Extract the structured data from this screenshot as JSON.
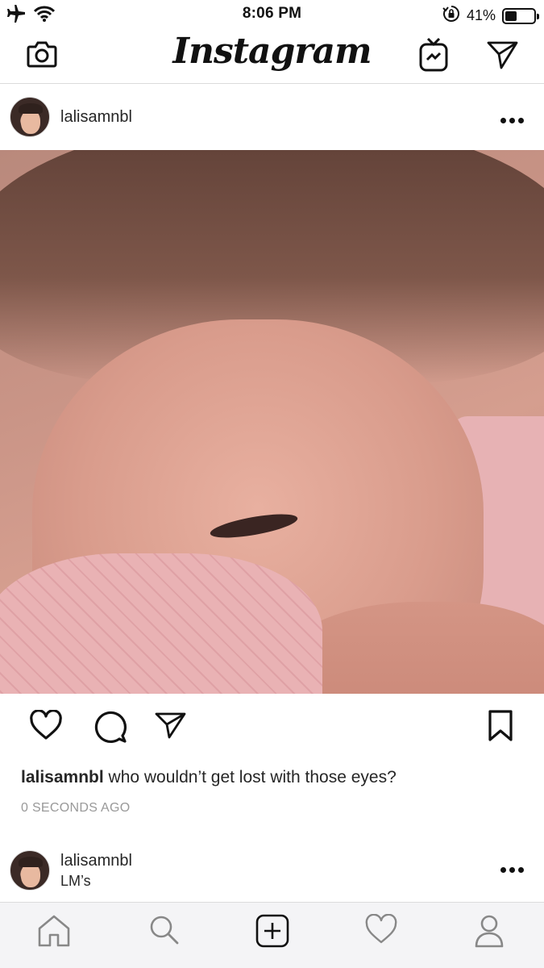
{
  "status_bar": {
    "time": "8:06 PM",
    "battery_percent_label": "41%",
    "battery_level": 0.41,
    "icons": [
      "airplane-icon",
      "wifi-icon",
      "orientation-lock-icon",
      "battery-icon"
    ]
  },
  "top_nav": {
    "logo": "Instagram",
    "icons": [
      "camera-icon",
      "igtv-icon",
      "direct-message-icon"
    ]
  },
  "post": {
    "username": "lalisamnbl",
    "caption_username": "lalisamnbl",
    "caption_text": " who wouldn’t get lost with those eyes?",
    "time_ago": "0 SECONDS AGO",
    "image_icon": "photo-of-person",
    "action_icons": [
      "heart-icon",
      "comment-icon",
      "share-icon",
      "bookmark-icon"
    ]
  },
  "next_post": {
    "username": "lalisamnbl",
    "location": "LM’s"
  },
  "tab_bar": {
    "icons": [
      "home-icon",
      "search-icon",
      "add-post-icon",
      "activity-heart-icon",
      "profile-icon"
    ],
    "active": "home-icon"
  },
  "colors": {
    "text": "#262626",
    "muted": "#999999",
    "tab_icon": "#888888",
    "tab_bar_bg": "#f4f4f6",
    "divider": "#dbdbdb"
  }
}
